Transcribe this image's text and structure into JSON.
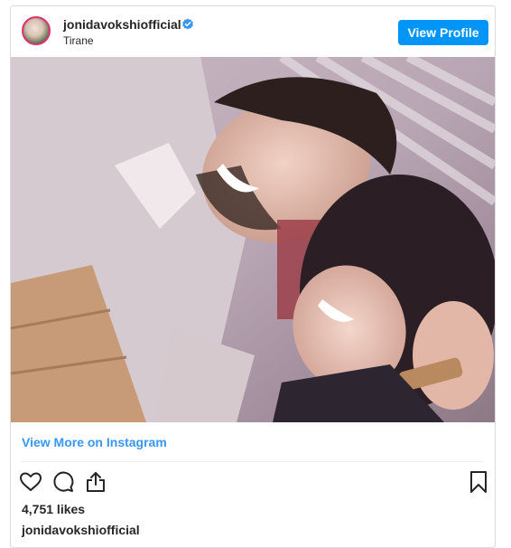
{
  "post": {
    "username": "jonidavokshiofficial",
    "location": "Tirane",
    "view_profile_label": "View Profile",
    "view_more_label": "View More on Instagram",
    "likes": "4,751 likes",
    "caption_username": "jonidavokshiofficial"
  },
  "icons": {
    "verified": "verified-badge-icon",
    "like": "heart-icon",
    "comment": "comment-icon",
    "share": "share-icon",
    "save": "bookmark-icon"
  },
  "colors": {
    "button_blue": "#0095f6",
    "link_blue": "#3897f0",
    "text": "#262626",
    "border": "#dbdbdb"
  }
}
